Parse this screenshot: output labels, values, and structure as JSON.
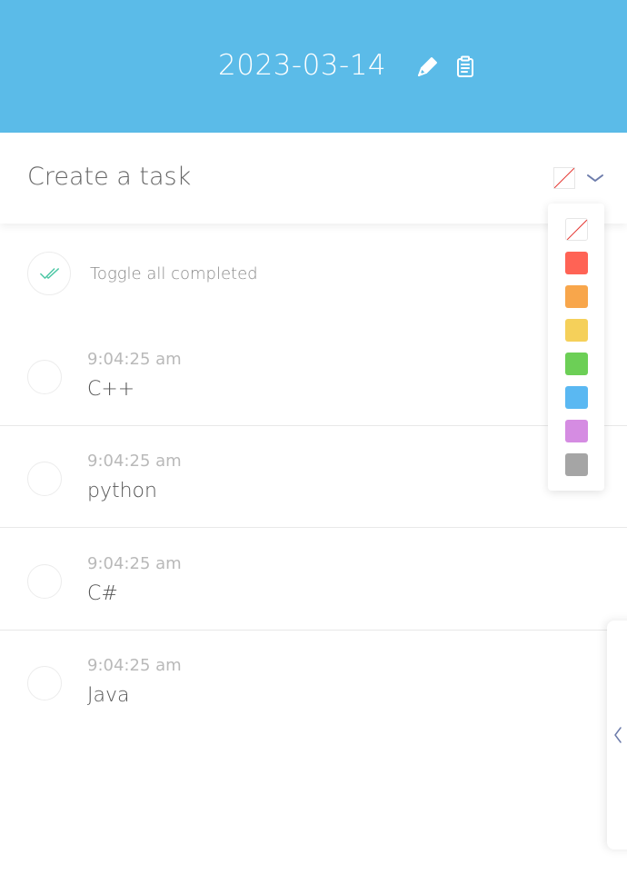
{
  "header": {
    "date": "2023-03-14",
    "icons": [
      "edit-icon",
      "clipboard-icon"
    ],
    "bg_color": "#5bbbe8"
  },
  "create": {
    "placeholder": "Create a task"
  },
  "color_picker": {
    "selected": "none",
    "options": [
      {
        "name": "none",
        "color": "#ffffff"
      },
      {
        "name": "red",
        "color": "#ff6355"
      },
      {
        "name": "orange",
        "color": "#f8a64b"
      },
      {
        "name": "yellow",
        "color": "#f5d05a"
      },
      {
        "name": "green",
        "color": "#6ccf56"
      },
      {
        "name": "blue",
        "color": "#5ab8f2"
      },
      {
        "name": "purple",
        "color": "#d58ce2"
      },
      {
        "name": "gray",
        "color": "#a5a5a5"
      }
    ]
  },
  "toggle_all": {
    "label": "Toggle all completed"
  },
  "tasks": [
    {
      "time": "9:04:25 am",
      "name": "C++"
    },
    {
      "time": "9:04:25 am",
      "name": "python"
    },
    {
      "time": "9:04:25 am",
      "name": "C#"
    },
    {
      "time": "9:04:25 am",
      "name": "Java"
    }
  ],
  "side_panel": {
    "icon": "chevron-left-icon"
  }
}
